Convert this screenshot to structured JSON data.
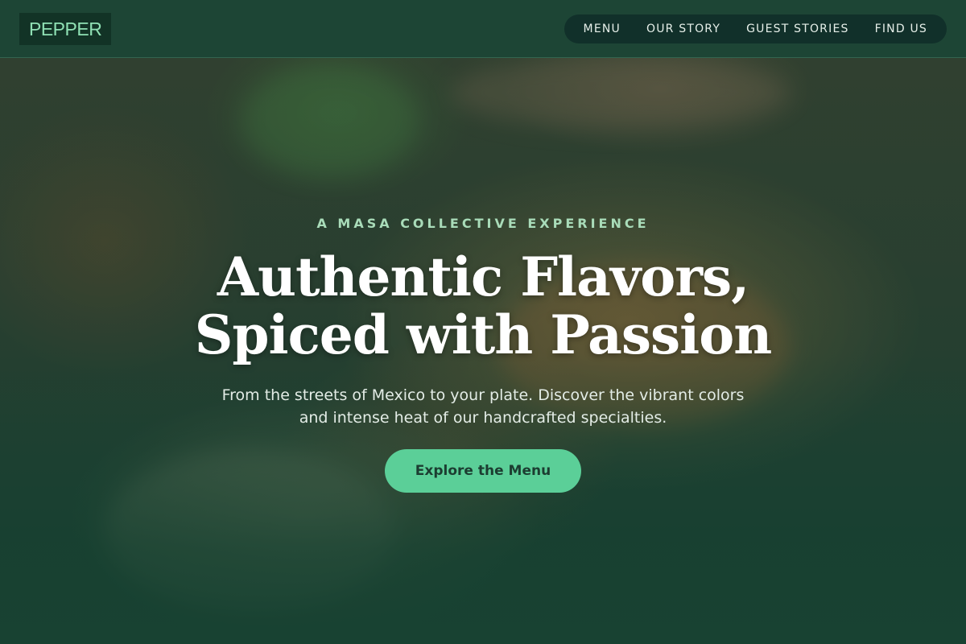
{
  "brand": {
    "logo_text": "PEPPER"
  },
  "nav": {
    "items": [
      {
        "label": "MENU"
      },
      {
        "label": "OUR STORY"
      },
      {
        "label": "GUEST STORIES"
      },
      {
        "label": "FIND US"
      }
    ]
  },
  "hero": {
    "eyebrow": "A MASA COLLECTIVE EXPERIENCE",
    "headline_line1": "Authentic Flavors,",
    "headline_line2": "Spiced with Passion",
    "subtitle_line1": "From the streets of Mexico to your plate. Discover the vibrant colors",
    "subtitle_line2": "and intense heat of our handcrafted specialties.",
    "cta_label": "Explore the Menu"
  },
  "colors": {
    "nav_bg": "#1d4535",
    "logo_text": "#8fe0b4",
    "accent": "#5bcf98",
    "eyebrow": "#a9dcb9"
  }
}
